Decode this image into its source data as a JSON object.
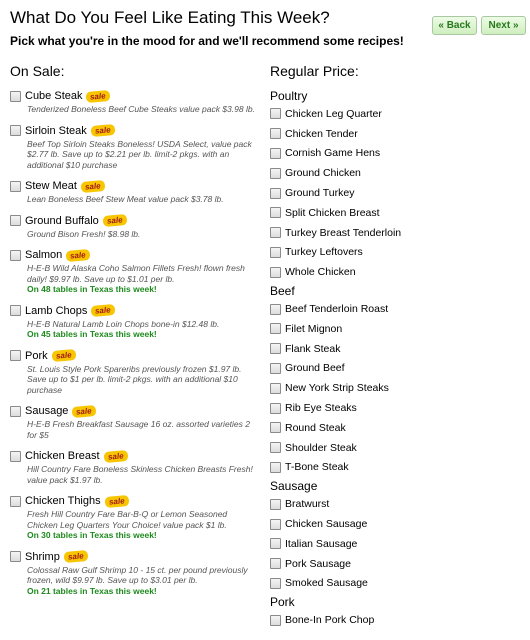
{
  "header": {
    "title": "What Do You Feel Like Eating This Week?",
    "subtitle": "Pick what you're in the mood for and we'll recommend some recipes!",
    "back_label": "« Back",
    "next_label": "Next »"
  },
  "on_sale": {
    "header": "On Sale:",
    "badge": "sale",
    "items": [
      {
        "name": "Cube Steak",
        "desc": "Tenderized Boneless Beef Cube Steaks value pack $3.98 lb.",
        "tables": ""
      },
      {
        "name": "Sirloin Steak",
        "desc": "Beef Top Sirloin Steaks Boneless! USDA Select, value pack $2.77 lb. Save up to $2.21 per lb. limit-2 pkgs. with an additional $10 purchase",
        "tables": ""
      },
      {
        "name": "Stew Meat",
        "desc": "Lean Boneless Beef Stew Meat value pack $3.78 lb.",
        "tables": ""
      },
      {
        "name": "Ground Buffalo",
        "desc": "Ground Bison Fresh! $8.98 lb.",
        "tables": ""
      },
      {
        "name": "Salmon",
        "desc": "H-E-B Wild Alaska Coho Salmon Fillets Fresh! flown fresh daily! $9.97 lb. Save up to $1.01 per lb.",
        "tables": "On 48 tables in Texas this week!"
      },
      {
        "name": "Lamb Chops",
        "desc": "H-E-B Natural Lamb Loin Chops bone-in $12.48 lb.",
        "tables": "On 45 tables in Texas this week!"
      },
      {
        "name": "Pork",
        "desc": "St. Louis Style Pork Spareribs previously frozen $1.97 lb. Save up to $1 per lb. limit-2 pkgs. with an additional $10 purchase",
        "tables": ""
      },
      {
        "name": "Sausage",
        "desc": "H-E-B Fresh Breakfast Sausage 16 oz. assorted varieties 2 for $5",
        "tables": ""
      },
      {
        "name": "Chicken Breast",
        "desc": "Hill Country Fare Boneless Skinless Chicken Breasts Fresh! value pack $1.97 lb.",
        "tables": ""
      },
      {
        "name": "Chicken Thighs",
        "desc": "Fresh Hill Country Fare Bar-B-Q or Lemon Seasoned Chicken Leg Quarters Your Choice! value pack $1 lb.",
        "tables": "On 30 tables in Texas this week!"
      },
      {
        "name": "Shrimp",
        "desc": "Colossal Raw Gulf Shrimp 10 - 15 ct. per pound previously frozen, wild $9.97 lb. Save up to $3.01 per lb.",
        "tables": "On 21 tables in Texas this week!"
      }
    ]
  },
  "regular": {
    "header": "Regular Price:",
    "categories": [
      {
        "name": "Poultry",
        "items": [
          "Chicken Leg Quarter",
          "Chicken Tender",
          "Cornish Game Hens",
          "Ground Chicken",
          "Ground Turkey",
          "Split Chicken Breast",
          "Turkey Breast Tenderloin",
          "Turkey Leftovers",
          "Whole Chicken"
        ]
      },
      {
        "name": "Beef",
        "items": [
          "Beef Tenderloin Roast",
          "Filet Mignon",
          "Flank Steak",
          "Ground Beef",
          "New York Strip Steaks",
          "Rib Eye Steaks",
          "Round Steak",
          "Shoulder Steak",
          "T-Bone Steak"
        ]
      },
      {
        "name": "Sausage",
        "items": [
          "Bratwurst",
          "Chicken Sausage",
          "Italian Sausage",
          "Pork Sausage",
          "Smoked Sausage"
        ]
      },
      {
        "name": "Pork",
        "items": [
          "Bone-In Pork Chop"
        ]
      }
    ]
  },
  "colors": {
    "badge_bg": "#f7c600",
    "badge_text": "#a51a1a",
    "tables_text": "#1e8a1e",
    "button_text": "#267a1c"
  }
}
